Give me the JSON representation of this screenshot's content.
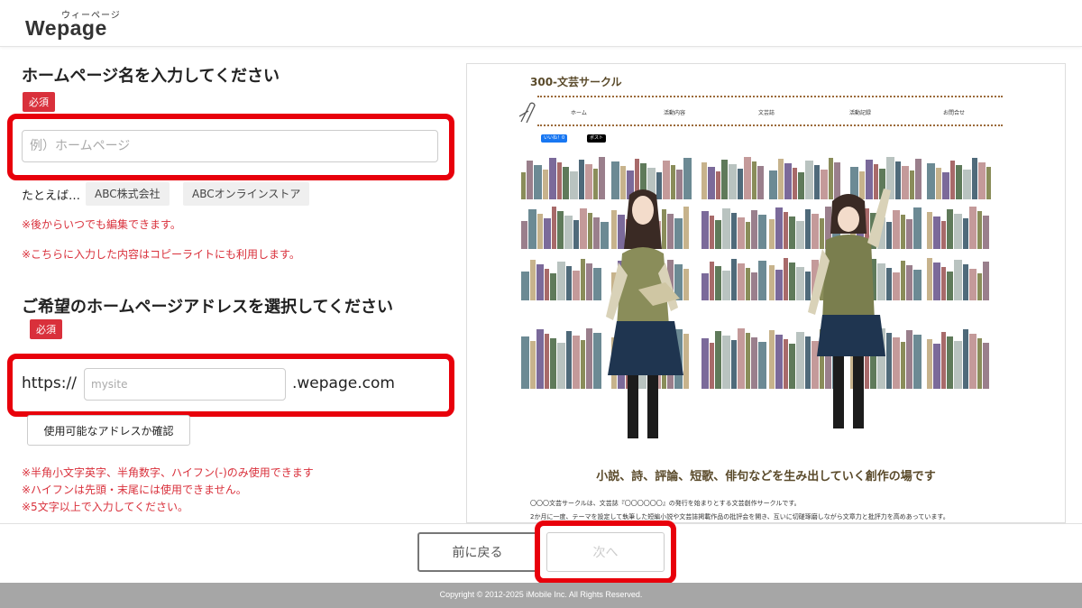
{
  "header": {
    "logo_sub": "ウィーページ",
    "logo": "Wepage"
  },
  "form": {
    "name_heading": "ホームページ名を入力してください",
    "required": "必須",
    "name_placeholder": "例）ホームページ",
    "example_label": "たとえば…",
    "examples": [
      "ABC株式会社",
      "ABCオンラインストア"
    ],
    "name_notes": [
      "※後からいつでも編集できます。",
      "※こちらに入力した内容はコピーライトにも利用します。"
    ],
    "address_heading": "ご希望のホームページアドレスを選択してください",
    "address_prefix": "https://",
    "address_placeholder": "mysite",
    "address_suffix": ".wepage.com",
    "check_button": "使用可能なアドレスか確認",
    "address_notes": [
      "※半角小文字英字、半角数字、ハイフン(-)のみ使用できます",
      "※ハイフンは先頭・末尾には使用できません。",
      "※5文字以上で入力してください。"
    ]
  },
  "preview": {
    "site_title": "300-文芸サークル",
    "nav": [
      "ホーム",
      "活動内容",
      "文芸誌",
      "活動記録",
      "お問合せ"
    ],
    "like_label": "いいね！0",
    "post_label": "ポスト",
    "tagline": "小説、詩、評論、短歌、俳句などを生み出していく創作の場です",
    "text1": "〇〇〇文芸サークルは、文芸誌『〇〇〇〇〇〇』の発行を始まりとする文芸創作サークルです。",
    "text2": "2か月に一度、テーマを設定して執筆した短編小説や文芸誌掲載作品の批評会を開き、互いに切磋琢磨しながら文章力と批評力を高めあっています。"
  },
  "footer": {
    "back": "前に戻る",
    "next": "次へ",
    "copyright": "Copyright © 2012-2025 iMobile Inc. All Rights Reserved."
  },
  "colors": {
    "required_badge": "#d9303b",
    "highlight": "#e8000b",
    "accent_brown": "#5a4a2a"
  }
}
